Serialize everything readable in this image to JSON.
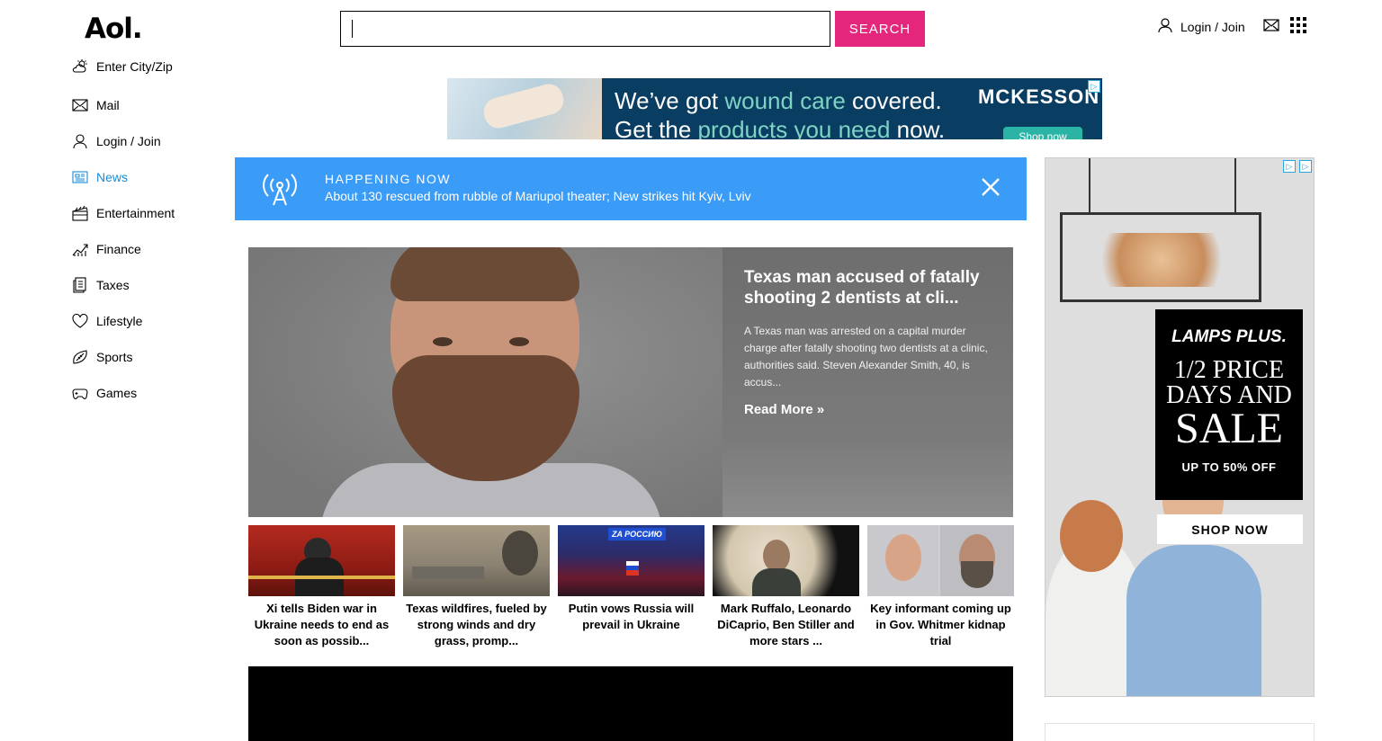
{
  "header": {
    "logo": "Aol.",
    "search_value": "",
    "search_button": "SEARCH",
    "login_label": "Login / Join",
    "icons": [
      "user-icon",
      "mail-icon",
      "apps-grid-icon"
    ]
  },
  "sidebar": {
    "items": [
      {
        "label": "Enter City/Zip",
        "icon": "weather-icon"
      },
      {
        "label": "Mail",
        "icon": "mail-icon"
      },
      {
        "label": "Login / Join",
        "icon": "user-icon"
      },
      {
        "label": "News",
        "icon": "news-icon",
        "active": true
      },
      {
        "label": "Entertainment",
        "icon": "clapperboard-icon"
      },
      {
        "label": "Finance",
        "icon": "chart-icon"
      },
      {
        "label": "Taxes",
        "icon": "document-icon"
      },
      {
        "label": "Lifestyle",
        "icon": "heart-icon"
      },
      {
        "label": "Sports",
        "icon": "football-icon"
      },
      {
        "label": "Games",
        "icon": "gamepad-icon"
      }
    ]
  },
  "top_ad": {
    "line1_a": "We’ve got ",
    "line1_accent": "wound care",
    "line1_b": " covered.",
    "line2_a": "Get the ",
    "line2_accent": "products you need",
    "line2_b": " now.",
    "brand": "MCKESSON",
    "cta": "Shop now"
  },
  "happening": {
    "title": "HAPPENING NOW",
    "text": "About 130 rescued from rubble of Mariupol theater; New strikes hit Kyiv, Lviv"
  },
  "hero": {
    "headline": "Texas man accused of fatally shooting 2 dentists at cli...",
    "summary": "A Texas man was arrested on a capital murder charge after fatally shooting two dentists at a clinic, authorities said. Steven Alexander Smith, 40, is accus...",
    "read_more": "Read More »"
  },
  "thumbs": [
    {
      "caption": "Xi tells Biden war in Ukraine needs to end as soon as possib..."
    },
    {
      "caption": "Texas wildfires, fueled by strong winds and dry grass, promp..."
    },
    {
      "caption": "Putin vows Russia will prevail in Ukraine",
      "sign": "ZA РОССИЮ"
    },
    {
      "caption": "Mark Ruffalo, Leonardo DiCaprio, Ben Stiller and more stars ..."
    },
    {
      "caption": "Key informant coming up in Gov. Whitmer kidnap trial"
    }
  ],
  "right_ad": {
    "brand": "LAMPS PLUS.",
    "deal": "1/2 PRICE DAYS AND",
    "sale": "SALE",
    "offer": "UP TO 50% OFF",
    "cta": "SHOP NOW"
  },
  "colors": {
    "accent_pink": "#e5267d",
    "happening_blue": "#3a9cf7",
    "nav_active": "#1a8bd6"
  }
}
